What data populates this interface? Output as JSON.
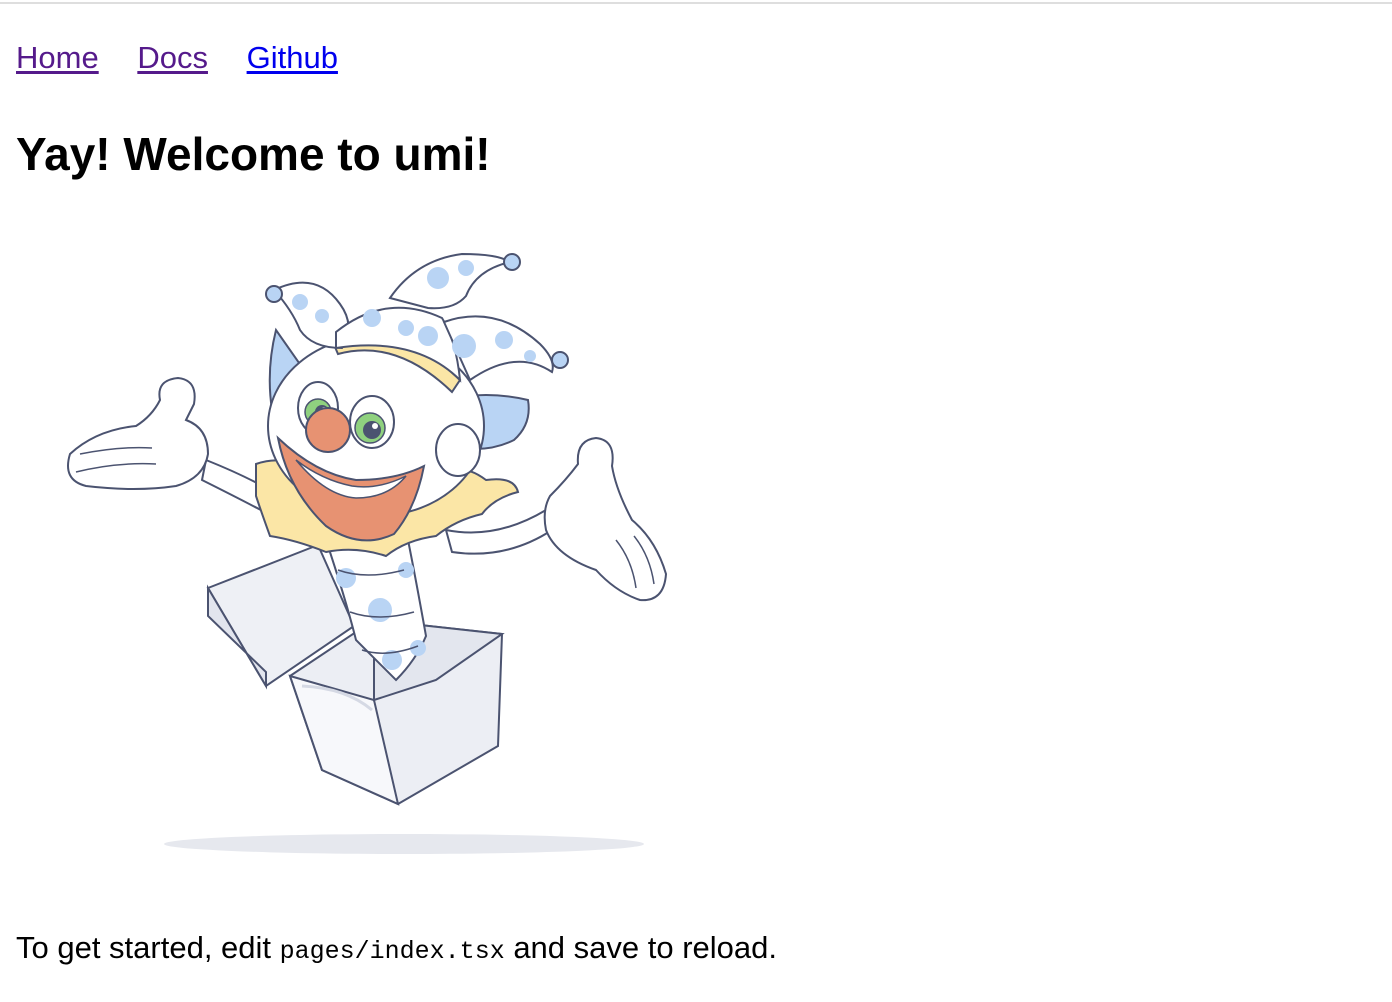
{
  "nav": {
    "links": [
      {
        "label": "Home",
        "state": "visited"
      },
      {
        "label": "Docs",
        "state": "visited"
      },
      {
        "label": "Github",
        "state": "unvisited"
      }
    ]
  },
  "main": {
    "title": "Yay! Welcome to umi!",
    "illustration": {
      "icon": "jester-in-box-illustration"
    },
    "instructions": {
      "before": "To get started, edit ",
      "code": "pages/index.tsx",
      "after": " and save to reload."
    }
  },
  "colors": {
    "link_visited": "#551a8b",
    "link_unvisited": "#0000ee",
    "divider": "#dedede"
  }
}
